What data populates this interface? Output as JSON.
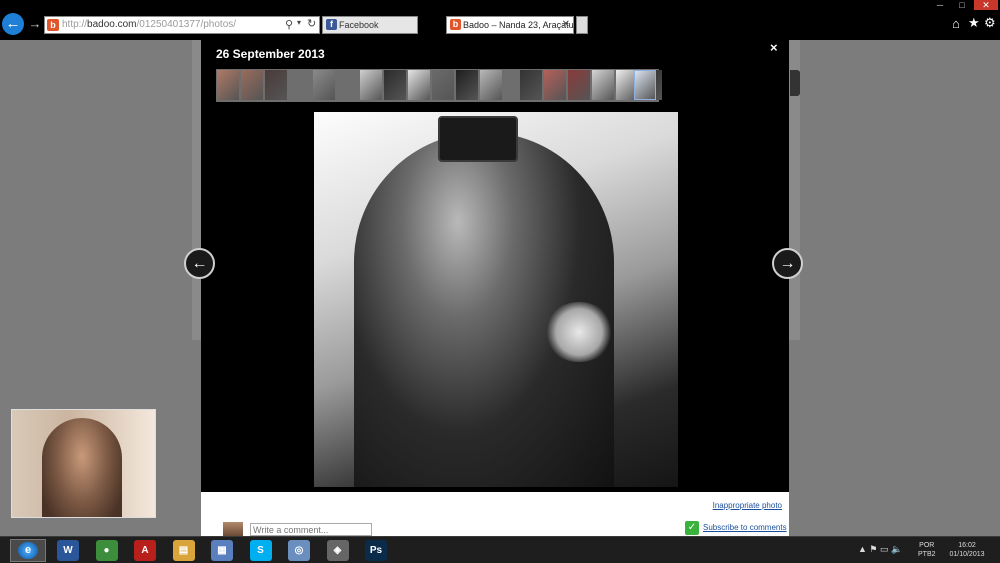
{
  "browser": {
    "url_prefix": "http://",
    "url_domain": "badoo.com",
    "url_path": "/01250401377/photos/",
    "tabs": [
      {
        "label": "Facebook",
        "icon": "facebook-icon"
      },
      {
        "label": "Badoo – Nanda 23, Araçatu...",
        "icon": "badoo-icon"
      }
    ]
  },
  "viewer": {
    "date": "26 September 2013",
    "report_link": "Inappropriate photo",
    "comment_placeholder": "Write a comment...",
    "subscribe_label": "Subscribe to comments",
    "thumbnails": [
      {
        "color": "#b07a66"
      },
      {
        "color": "#9a6c5c"
      },
      {
        "color": "#4a3a3a"
      },
      {
        "color": "#8a8a8a"
      },
      {
        "color": "#cfcfcf"
      },
      {
        "color": "#2b2b2b"
      },
      {
        "color": "#e5e5e5"
      },
      {
        "color": "#6b6b6b"
      },
      {
        "color": "#1e1e1e"
      },
      {
        "color": "#b8b8b8"
      },
      {
        "color": "#333333"
      },
      {
        "color": "#b5605a"
      },
      {
        "color": "#8a3a3a"
      },
      {
        "color": "#d5d5d5"
      },
      {
        "color": "#efefef"
      },
      {
        "color": "#2a2a2a"
      },
      {
        "color": "#dbe4f0"
      }
    ]
  },
  "taskbar": {
    "apps": [
      {
        "name": "word-icon",
        "label": "W",
        "color": "#2b579a"
      },
      {
        "name": "chrome-icon",
        "label": "●",
        "color": "#3c8e3c"
      },
      {
        "name": "acrobat-icon",
        "label": "A",
        "color": "#b8201b"
      },
      {
        "name": "explorer-folder-icon",
        "label": "▤",
        "color": "#d9a53a"
      },
      {
        "name": "remote-desktop-icon",
        "label": "▦",
        "color": "#5a7fbf"
      },
      {
        "name": "skype-icon",
        "label": "S",
        "color": "#00aff0"
      },
      {
        "name": "network-icon",
        "label": "◎",
        "color": "#6a8fbf"
      },
      {
        "name": "media-app-icon",
        "label": "◈",
        "color": "#666666"
      },
      {
        "name": "photoshop-icon",
        "label": "Ps",
        "color": "#0b2b4a"
      }
    ],
    "language": "POR",
    "keyboard": "PTB2",
    "time": "16:02",
    "date": "01/10/2013"
  }
}
